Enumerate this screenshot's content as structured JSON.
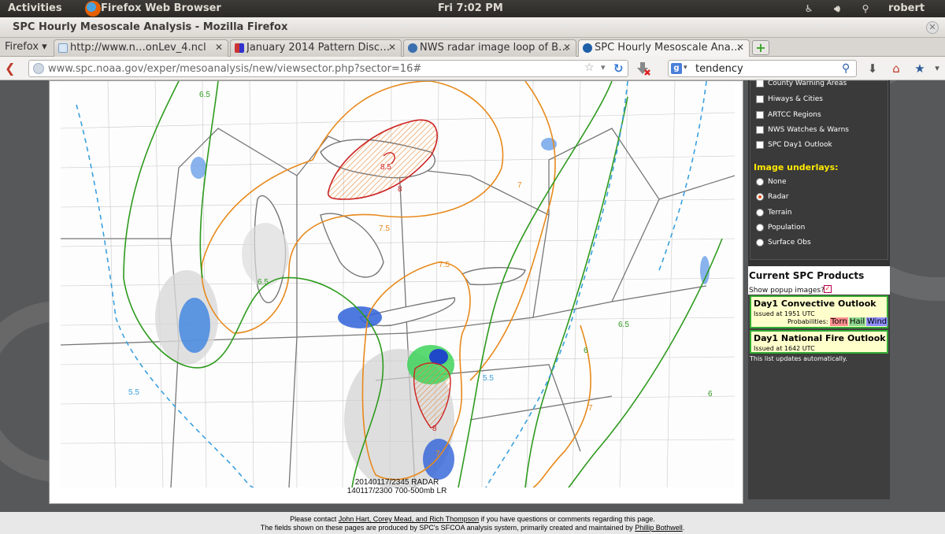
{
  "system_panel": {
    "activities": "Activities",
    "app_name": "Firefox Web Browser",
    "clock": "Fri  7:02 PM",
    "user": "robert"
  },
  "window": {
    "title": "SPC Hourly Mesoscale Analysis - Mozilla Firefox"
  },
  "tabs": {
    "menu_label": "Firefox",
    "items": [
      {
        "label": "http://www.n…onLev_4.ncl"
      },
      {
        "label": "January 2014 Pattern Disc…"
      },
      {
        "label": "NWS radar image loop of B…"
      },
      {
        "label": "SPC Hourly Mesoscale Ana…"
      }
    ]
  },
  "navbar": {
    "url": "www.spc.noaa.gov/exper/mesoanalysis/new/viewsector.php?sector=16#",
    "search_query": "tendency"
  },
  "map": {
    "caption_line1": "20140117/2345 RADAR",
    "caption_line2": "140117/2300 700-500mb LR",
    "contour_labels": [
      "6.5",
      "5.5",
      "6.5",
      "8",
      "8.5",
      "7.5",
      "7",
      "7.5",
      "6.5",
      "6",
      "7",
      "6",
      "8",
      "5.5",
      "7"
    ]
  },
  "sidebar": {
    "layers": [
      {
        "label": "County Warning Areas",
        "checked": false
      },
      {
        "label": "Hiways & Cities",
        "checked": false
      },
      {
        "label": "ARTCC Regions",
        "checked": false
      },
      {
        "label": "NWS Watches & Warns",
        "checked": false
      },
      {
        "label": "SPC Day1 Outlook",
        "checked": false
      }
    ],
    "underlays_heading": "Image underlays:",
    "underlays": [
      {
        "label": "None",
        "selected": false
      },
      {
        "label": "Radar",
        "selected": true
      },
      {
        "label": "Terrain",
        "selected": false
      },
      {
        "label": "Population",
        "selected": false
      },
      {
        "label": "Surface Obs",
        "selected": false
      }
    ],
    "products_heading": "Current SPC Products",
    "popup_label": "Show popup images?",
    "products": [
      {
        "title": "Day1 Convective Outlook",
        "issued": "Issued at 1951 UTC",
        "probabilities_label": "Probabilities:",
        "torn": "Torn",
        "hail": "Hail",
        "wind": "Wind"
      },
      {
        "title": "Day1 National Fire Outlook",
        "issued": "Issued at 1642 UTC"
      }
    ],
    "updates_note": "This list updates automatically."
  },
  "footer": {
    "line1_pre": "Please contact",
    "contacts": "John Hart, Corey Mead, and Rich Thompson",
    "line1_post": "if you have questions or comments regarding this page.",
    "line2_pre": "The fields shown on these pages are produced by SPC's SFCOA analysis system, primarily created and maintained by",
    "maintainer": "Phillip Bothwell",
    "line2_post": "."
  },
  "colors": {
    "contour_green": "#2e9a1e",
    "contour_orange": "#e8891c",
    "contour_red": "#cc2222",
    "contour_blue_dashed": "#3aa0dd",
    "sidebar_heading_yellow": "#ffe800",
    "product_card_bg": "#ffffcc",
    "torn_bg": "#ff8f8f",
    "hail_bg": "#8fd88f",
    "wind_bg": "#8f8fff"
  }
}
